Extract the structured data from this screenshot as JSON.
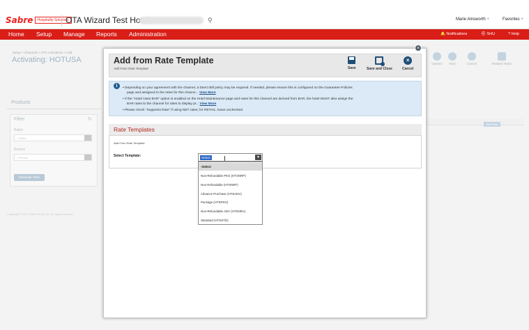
{
  "brand": {
    "logo_word": "Sabre",
    "logo_sub": "Hospitality Solutions.",
    "accent": "#d91e18"
  },
  "topbar": {
    "hotel_title": "OTA Wizard Test Hotel -",
    "search_icon": "search-icon",
    "user_name": "Marie Ainsworth",
    "favorites": "Favorites"
  },
  "nav": {
    "items": [
      "Home",
      "Setup",
      "Manage",
      "Reports",
      "Administration"
    ],
    "notifications": "Notifications",
    "property": "SHU",
    "help": "Help"
  },
  "background": {
    "breadcrumb": "Setup > Channels > OTA Activations > Add",
    "page_title": "Activating: HOTUSA",
    "products": "Products",
    "filter": "Filter",
    "rates_label": "Rates",
    "rates_value": "1 Rates",
    "rooms_label": "Rooms",
    "rooms_value": "1 Rooms",
    "generate_button": "Generate View",
    "copyright": "Copyright © 2017 Sabre GLBL Inc. All rights reserved.",
    "actions": [
      "Options",
      "Next",
      "Cancel",
      "Related Tasks"
    ],
    "edit_button": "Edit Rate"
  },
  "modal": {
    "title": "Add from Rate Template",
    "subtitle": "Add From Rate Template",
    "buttons": {
      "save": "Save",
      "save_close": "Save and Close",
      "cancel": "Cancel"
    },
    "info": {
      "line1": "Depending on your agreement with the channel, a Direct Bill policy may be required. If needed, please ensure this is configured on the Guarantee Policies",
      "line1b": "page and assigned to the rates for this channe...",
      "line1b_link": "View More",
      "line2": "If the \"Hotel Uses BAR\" option is enabled on the Hotel Maintenance page and rates for this channel are derived from BAR, the hotel MUST also assign the",
      "line2b": "BAR rates to the channel for rates to display pr...",
      "line2b_link": "View More",
      "line3": "Please check \"Suppress Rate\" if using NET rates; for RETAIL, leave unchecked"
    },
    "rate_templates": {
      "title": "Rate Templates",
      "subtitle": "Add From Rate Template",
      "select_label": "Select Template:",
      "selected_value": "-Select-",
      "options": [
        "-Select-",
        "Non-Refundable PKG (HTSNRP)",
        "Non Refundable (HTSNRF)",
        "Advance Purchase (HTSADV)",
        "Package (HTSPKG)",
        "Non-Refundable ADV (HTSNRA)",
        "Standard (HTSSTD)"
      ]
    }
  }
}
